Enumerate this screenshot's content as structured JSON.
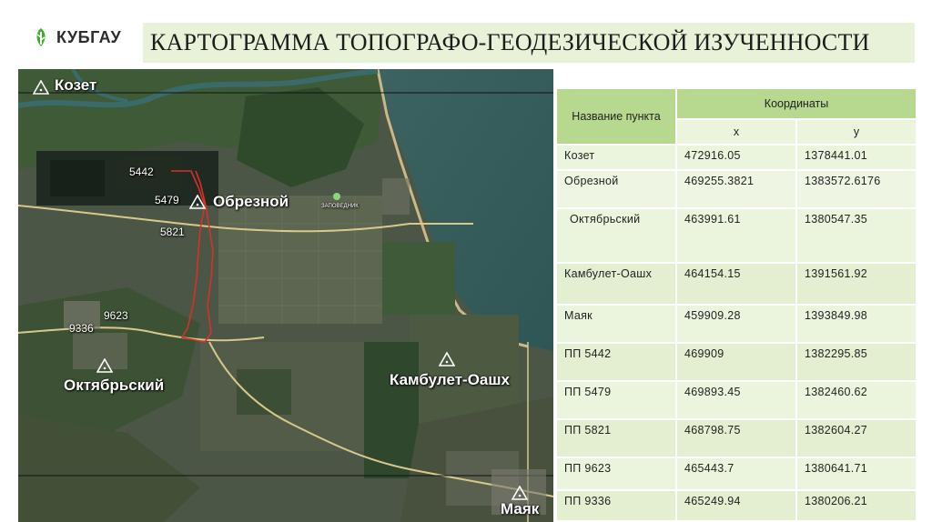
{
  "logo": {
    "text": "КУБГАУ",
    "icon": "leaf-logo-icon",
    "color": "#3fae29"
  },
  "title": "КАРТОГРАММА ТОПОГРАФО-ГЕОДЕЗИЧЕСКОЙ ИЗУЧЕННОСТИ",
  "colors": {
    "title_band": "#e7f2d9",
    "header_green": "#b6d98f",
    "row_green": "#ebf5dd",
    "route_red": "#d9302a"
  },
  "map": {
    "labels": {
      "kozet": "Козет",
      "obreznoy": "Обрезной",
      "oktyabrsky": "Октябрьский",
      "kambulet": "Камбулет-Оашх",
      "mayak": "Маяк",
      "p5442": "5442",
      "p5479": "5479",
      "p5821": "5821",
      "p9623": "9623",
      "p9336": "9336",
      "reserve": "ЗАПОВЕДНИК"
    }
  },
  "table": {
    "headers": {
      "name": "Название пункта",
      "coords": "Координаты",
      "x": "x",
      "y": "y"
    },
    "rows": [
      {
        "name": "Козет",
        "x": "472916.05",
        "y": "1378441.01"
      },
      {
        "name": "Обрезной",
        "x": "469255.3821",
        "y": "1383572.6176"
      },
      {
        "name": "Октябрьский",
        "x": "463991.61",
        "y": "1380547.35"
      },
      {
        "name": "Камбулет-Оашх",
        "x": "464154.15",
        "y": "1391561.92"
      },
      {
        "name": "Маяк",
        "x": "459909.28",
        "y": "1393849.98"
      },
      {
        "name": "ПП 5442",
        "x": "469909",
        "y": "1382295.85"
      },
      {
        "name": "ПП 5479",
        "x": "469893.45",
        "y": "1382460.62"
      },
      {
        "name": "ПП 5821",
        "x": "468798.75",
        "y": "1382604.27"
      },
      {
        "name": "ПП 9623",
        "x": "465443.7",
        "y": "1380641.71"
      },
      {
        "name": "ПП 9336",
        "x": "465249.94",
        "y": "1380206.21"
      }
    ]
  }
}
